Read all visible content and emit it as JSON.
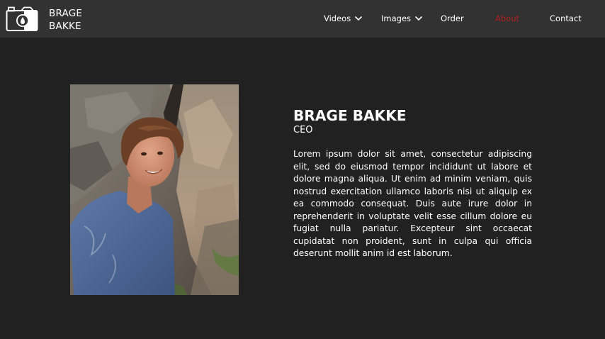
{
  "brand": {
    "line1": "BRAGE",
    "line2": "BAKKE",
    "icon": "camera-logo-icon"
  },
  "nav": {
    "items": [
      {
        "label": "Videos",
        "dropdown": true
      },
      {
        "label": "Images",
        "dropdown": true
      },
      {
        "label": "Order",
        "dropdown": false
      },
      {
        "label": "About",
        "dropdown": false,
        "active": true
      },
      {
        "label": "Contact",
        "dropdown": false
      }
    ]
  },
  "profile": {
    "name": "BRAGE BAKKE",
    "role": "CEO",
    "bio": "Lorem ipsum dolor sit amet, consectetur adipiscing elit, sed do eiusmod tempor incididunt ut labore et dolore magna aliqua. Ut enim ad minim veniam, quis nostrud exercitation ullamco laboris nisi ut aliquip ex ea commodo consequat. Duis aute irure dolor in reprehenderit in voluptate velit esse cillum dolore eu fugiat nulla pariatur. Excepteur sint occaecat cupidatat non proident, sunt in culpa qui officia deserunt mollit anim id est laborum."
  },
  "colors": {
    "background": "#212121",
    "navbar": "#323232",
    "text": "#ffffff",
    "active_nav": "#b01f1f"
  }
}
